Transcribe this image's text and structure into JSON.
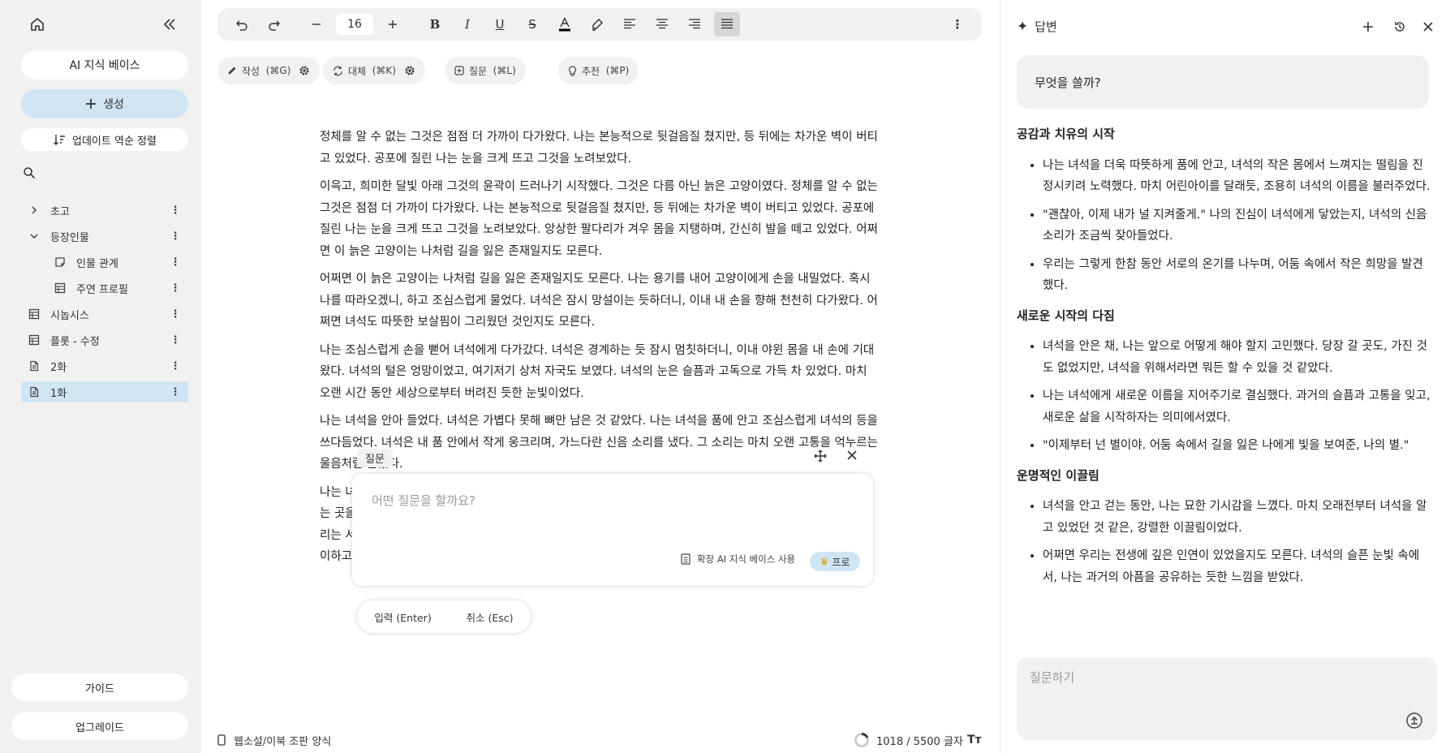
{
  "sidebar": {
    "home_icon": "home-icon",
    "collapse_icon": "double-chevron-left-icon",
    "kb_label": "AI 지식 베이스",
    "create_label": "생성",
    "sort_label": "업데이트 역순 정렬",
    "search_icon": "search-icon",
    "tree": [
      {
        "label": "초고",
        "icon": "chevron-right-icon",
        "level": 0
      },
      {
        "label": "등장인물",
        "icon": "chevron-down-icon",
        "level": 0
      },
      {
        "label": "인물 관계",
        "icon": "note-icon",
        "level": 1
      },
      {
        "label": "주연 프로필",
        "icon": "table-icon",
        "level": 1
      },
      {
        "label": "시놉시스",
        "icon": "table-icon",
        "level": 0
      },
      {
        "label": "플롯 - 수정",
        "icon": "table-icon",
        "level": 0
      },
      {
        "label": "2화",
        "icon": "document-icon",
        "level": 0
      },
      {
        "label": "1화",
        "icon": "document-icon",
        "level": 0,
        "active": true
      }
    ],
    "guide_label": "가이드",
    "upgrade_label": "업그레이드"
  },
  "toolbar": {
    "font_size": "16",
    "undo_icon": "undo-icon",
    "redo_icon": "redo-icon"
  },
  "chips": [
    {
      "label": "작성",
      "shortcut": "(⌘G)",
      "icon": "pen-icon",
      "gear": true
    },
    {
      "label": "대체",
      "shortcut": "(⌘K)",
      "icon": "replace-icon",
      "gear": true
    },
    {
      "label": "질문",
      "shortcut": "(⌘L)",
      "icon": "question-icon",
      "gear": false
    },
    {
      "label": "추천",
      "shortcut": "(⌘P)",
      "icon": "bulb-icon",
      "gear": false
    }
  ],
  "content": {
    "paragraphs": [
      "정체를 알 수 없는 그것은 점점 더 가까이 다가왔다. 나는 본능적으로 뒷걸음질 쳤지만, 등 뒤에는 차가운 벽이 버티고 있었다. 공포에 질린 나는 눈을 크게 뜨고 그것을 노려보았다.",
      "이윽고, 희미한 달빛 아래 그것의 윤곽이 드러나기 시작했다. 그것은 다름 아닌 늙은 고양이였다. 정체를 알 수 없는 그것은 점점 더 가까이 다가왔다. 나는 본능적으로 뒷걸음질 쳤지만, 등 뒤에는 차가운 벽이 버티고 있었다. 공포에 질린 나는 눈을 크게 뜨고 그것을 노려보았다. 앙상한 팔다리가 겨우 몸을 지탱하며, 간신히 발을 떼고 있었다. 어쩌면 이 늙은 고양이는 나처럼 길을 잃은 존재일지도 모른다.",
      "어쩌면 이 늙은 고양이는 나처럼 길을 잃은 존재일지도 모른다. 나는 용기를 내어 고양이에게 손을 내밀었다. 혹시 나를 따라오겠니, 하고 조심스럽게 물었다. 녀석은 잠시 망설이는 듯하더니, 이내 내 손을 향해 천천히 다가왔다. 어쩌면 녀석도 따뜻한 보살핌이 그리웠던 것인지도 모른다.",
      "나는 조심스럽게 손을 뻗어 녀석에게 다가갔다. 녀석은 경계하는 듯 잠시 멈칫하더니, 이내 야윈 몸을 내 손에 기대왔다. 녀석의 털은 엉망이었고, 여기저기 상처 자국도 보였다. 녀석의 눈은 슬픔과 고독으로 가득 차 있었다. 마치 오랜 시간 동안 세상으로부터 버려진 듯한 눈빛이었다.",
      "나는 녀석을 안아 들었다. 녀석은 가볍다 못해 뼈만 남은 것 같았다. 나는 녀석을 품에 안고 조심스럽게 녀석의 등을 쓰다듬었다. 녀석은 내 품 안에서 작게 웅크리며, 가느다란 신음 소리를 냈다. 그 소리는 마치 오랜 고통을 억누르는 울음처럼 들렸다.",
      "나는 녀 ",
      "는 곳을 ",
      "리는 서 ",
      "이하고 "
    ]
  },
  "question_popup": {
    "tag": "질문",
    "placeholder": "어떤 질문을 할까요?",
    "kb_toggle": "확장 AI 지식 베이스 사용",
    "pro_label": "프로",
    "submit_label": "입력 (Enter)",
    "cancel_label": "취소 (Esc)"
  },
  "status": {
    "mode": "웹소설/이북 조판 양식",
    "count": "1018 / 5500 글자",
    "text_size_icon": "Tт",
    "progress": 0.185
  },
  "panel": {
    "title": "답변",
    "prompt": "무엇을 쓸까?",
    "sections": [
      {
        "heading": "공감과 치유의 시작",
        "items": [
          "나는 녀석을 더욱 따뜻하게 품에 안고, 녀석의 작은 몸에서 느껴지는 떨림을 진정시키려 노력했다. 마치 어린아이를 달래듯, 조용히 녀석의 이름을 불러주었다.",
          "\"괜찮아, 이제 내가 널 지켜줄게.\" 나의 진심이 녀석에게 닿았는지, 녀석의 신음 소리가 조금씩 잦아들었다.",
          "우리는 그렇게 한참 동안 서로의 온기를 나누며, 어둠 속에서 작은 희망을 발견했다."
        ]
      },
      {
        "heading": "새로운 시작의 다짐",
        "items": [
          "녀석을 안은 채, 나는 앞으로 어떻게 해야 할지 고민했다. 당장 갈 곳도, 가진 것도 없었지만, 녀석을 위해서라면 뭐든 할 수 있을 것 같았다.",
          "나는 녀석에게 새로운 이름을 지어주기로 결심했다. 과거의 슬픔과 고통을 잊고, 새로운 삶을 시작하자는 의미에서였다.",
          "\"이제부터 넌 별이야. 어둠 속에서 길을 잃은 나에게 빛을 보여준, 나의 별.\""
        ]
      },
      {
        "heading": "운명적인 이끌림",
        "items": [
          "녀석을 안고 걷는 동안, 나는 묘한 기시감을 느꼈다. 마치 오래전부터 녀석을 알고 있었던 것 같은, 강렬한 이끌림이었다.",
          "어쩌면 우리는 전생에 깊은 인연이 있었을지도 모른다. 녀석의 슬픈 눈빛 속에서, 나는 과거의 아픔을 공유하는 듯한 느낌을 받았다."
        ]
      }
    ],
    "ask_placeholder": "질문하기"
  }
}
